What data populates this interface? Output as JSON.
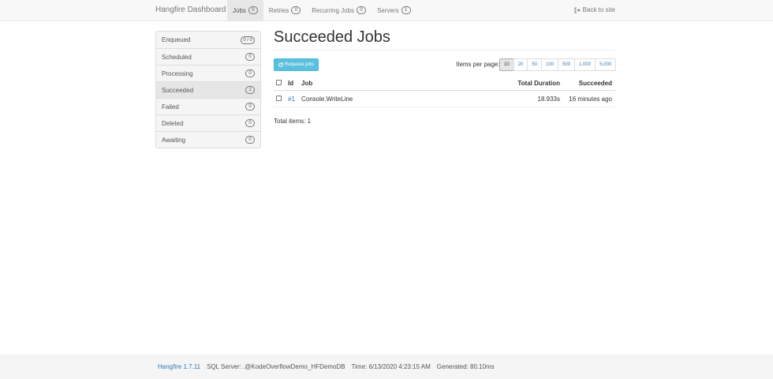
{
  "navbar": {
    "brand": "Hangfire Dashboard",
    "items": [
      {
        "label": "Jobs",
        "count": "0",
        "active": true
      },
      {
        "label": "Retries",
        "count": "0"
      },
      {
        "label": "Recurring Jobs",
        "count": "0"
      },
      {
        "label": "Servers",
        "count": "1"
      }
    ],
    "back_link": "Back to site"
  },
  "sidebar": {
    "items": [
      {
        "label": "Enqueued",
        "count": "0 / 0"
      },
      {
        "label": "Scheduled",
        "count": "0"
      },
      {
        "label": "Processing",
        "count": "0"
      },
      {
        "label": "Succeeded",
        "count": "1",
        "active": true
      },
      {
        "label": "Failed",
        "count": "0"
      },
      {
        "label": "Deleted",
        "count": "0"
      },
      {
        "label": "Awaiting",
        "count": "0"
      }
    ]
  },
  "main": {
    "title": "Succeeded Jobs",
    "requeue_label": "Requeue jobs",
    "items_per_page_label": "Items per page:",
    "page_sizes": [
      "10",
      "20",
      "50",
      "100",
      "500",
      "1,000",
      "5,000"
    ],
    "selected_page_size": "10",
    "table": {
      "columns": {
        "id": "Id",
        "job": "Job",
        "duration": "Total Duration",
        "succeeded": "Succeeded"
      },
      "rows": [
        {
          "id": "#1",
          "job": "Console.WriteLine",
          "duration": "18.933s",
          "succeeded": "16 minutes ago"
        }
      ]
    },
    "total_items": "Total items: 1"
  },
  "footer": {
    "version": "Hangfire 1.7.11",
    "sql_server": "SQL Server: .@KodeOverflowDemo_HFDemoDB",
    "time": "Time: 6/13/2020 4:23:15 AM",
    "generated": "Generated: 80.10ms"
  },
  "colors": {
    "link": "#337ab7",
    "info_button": "#5bc0de",
    "navbar_bg": "#f8f8f8",
    "footer_bg": "#f5f5f5"
  }
}
